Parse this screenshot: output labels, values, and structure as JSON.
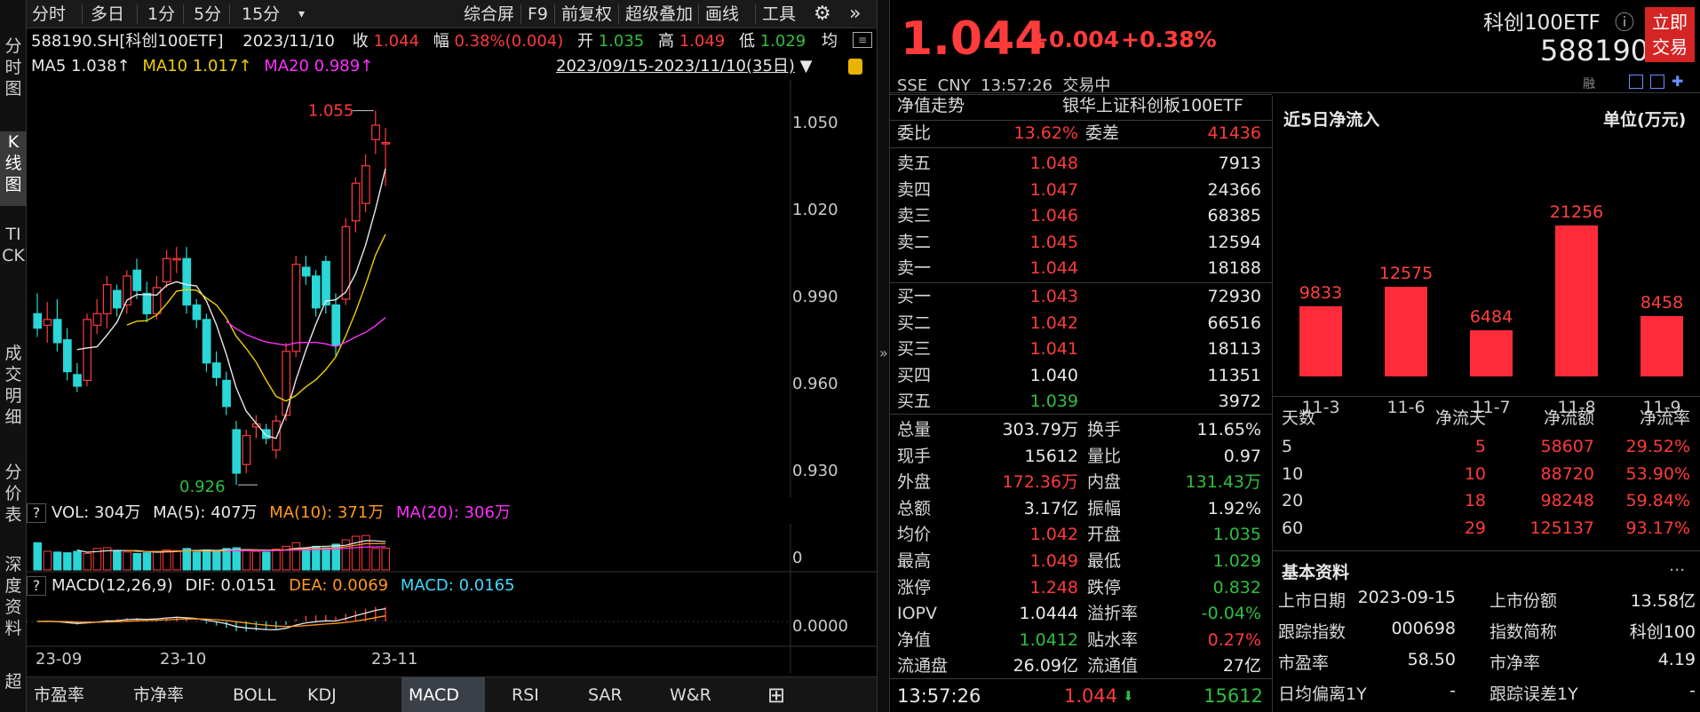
{
  "vtabs": [
    "分时图",
    "K线图",
    "TICK",
    "成交明细",
    "分价表",
    "深度资料",
    "超"
  ],
  "toolbar": {
    "left": [
      "分时",
      "多日",
      "1分",
      "5分",
      "15分"
    ],
    "dropdown": "▾",
    "right": [
      "综合屏",
      "F9",
      "前复权",
      "超级叠加",
      "画线",
      "工具"
    ],
    "gear_icon": "⚙",
    "more_icon": "»"
  },
  "info": {
    "code_name": "588190.SH[科创100ETF]",
    "date": "2023/11/10",
    "close_label": "收",
    "close": "1.044",
    "change_label": "幅",
    "change": "0.38%(0.004)",
    "open_label": "开",
    "open": "1.035",
    "high_label": "高",
    "high": "1.049",
    "low_label": "低",
    "low": "1.029",
    "trailing": "均"
  },
  "ma": {
    "ma5": "MA5 1.038↑",
    "ma10": "MA10 1.017↑",
    "ma20": "MA20 0.989↑",
    "range": "2023/09/15-2023/11/10(35日)",
    "range_arrow": "▼"
  },
  "price_axis": [
    "1.050",
    "1.020",
    "0.990",
    "0.960",
    "0.930"
  ],
  "annotations": {
    "high": "1.055",
    "low": "0.926"
  },
  "candles": [
    {
      "o": 0.985,
      "h": 0.992,
      "l": 0.977,
      "c": 0.98
    },
    {
      "o": 0.981,
      "h": 0.989,
      "l": 0.975,
      "c": 0.983
    },
    {
      "o": 0.983,
      "h": 0.99,
      "l": 0.972,
      "c": 0.975
    },
    {
      "o": 0.976,
      "h": 0.98,
      "l": 0.962,
      "c": 0.965
    },
    {
      "o": 0.964,
      "h": 0.968,
      "l": 0.958,
      "c": 0.96
    },
    {
      "o": 0.962,
      "h": 0.985,
      "l": 0.96,
      "c": 0.983
    },
    {
      "o": 0.981,
      "h": 0.99,
      "l": 0.978,
      "c": 0.985
    },
    {
      "o": 0.985,
      "h": 0.998,
      "l": 0.98,
      "c": 0.995
    },
    {
      "o": 0.993,
      "h": 0.995,
      "l": 0.984,
      "c": 0.987
    },
    {
      "o": 0.988,
      "h": 1.0,
      "l": 0.985,
      "c": 0.998
    },
    {
      "o": 1.0,
      "h": 1.004,
      "l": 0.99,
      "c": 0.993
    },
    {
      "o": 0.992,
      "h": 0.996,
      "l": 0.982,
      "c": 0.985
    },
    {
      "o": 0.985,
      "h": 0.998,
      "l": 0.983,
      "c": 0.994
    },
    {
      "o": 0.996,
      "h": 1.007,
      "l": 0.994,
      "c": 1.004
    },
    {
      "o": 1.004,
      "h": 1.008,
      "l": 0.999,
      "c": 1.004
    },
    {
      "o": 1.004,
      "h": 1.008,
      "l": 0.985,
      "c": 0.988
    },
    {
      "o": 0.988,
      "h": 0.99,
      "l": 0.98,
      "c": 0.983
    },
    {
      "o": 0.983,
      "h": 0.985,
      "l": 0.965,
      "c": 0.968
    },
    {
      "o": 0.968,
      "h": 0.972,
      "l": 0.96,
      "c": 0.963
    },
    {
      "o": 0.962,
      "h": 0.965,
      "l": 0.95,
      "c": 0.953
    },
    {
      "o": 0.945,
      "h": 0.948,
      "l": 0.926,
      "c": 0.93
    },
    {
      "o": 0.933,
      "h": 0.945,
      "l": 0.93,
      "c": 0.943
    },
    {
      "o": 0.946,
      "h": 0.95,
      "l": 0.942,
      "c": 0.947
    },
    {
      "o": 0.945,
      "h": 0.947,
      "l": 0.94,
      "c": 0.942
    },
    {
      "o": 0.938,
      "h": 0.95,
      "l": 0.935,
      "c": 0.948
    },
    {
      "o": 0.95,
      "h": 0.975,
      "l": 0.948,
      "c": 0.972
    },
    {
      "o": 0.972,
      "h": 1.005,
      "l": 0.97,
      "c": 1.002
    },
    {
      "o": 1.001,
      "h": 1.005,
      "l": 0.995,
      "c": 0.998
    },
    {
      "o": 0.998,
      "h": 1.0,
      "l": 0.984,
      "c": 0.987
    },
    {
      "o": 1.003,
      "h": 1.005,
      "l": 0.985,
      "c": 0.988
    },
    {
      "o": 0.988,
      "h": 0.992,
      "l": 0.97,
      "c": 0.974
    },
    {
      "o": 0.99,
      "h": 1.018,
      "l": 0.988,
      "c": 1.015
    },
    {
      "o": 1.017,
      "h": 1.032,
      "l": 1.013,
      "c": 1.03
    },
    {
      "o": 1.023,
      "h": 1.04,
      "l": 1.02,
      "c": 1.036
    },
    {
      "o": 1.045,
      "h": 1.055,
      "l": 1.04,
      "c": 1.05
    },
    {
      "o": 1.044,
      "h": 1.049,
      "l": 1.029,
      "c": 1.044
    }
  ],
  "vol_header": {
    "q": "?",
    "vol": "VOL: 304万",
    "ma5": "MA(5): 407万",
    "ma10": "MA(10): 371万",
    "ma20": "MA(20): 306万",
    "zero": "0"
  },
  "volumes": [
    380,
    260,
    250,
    240,
    260,
    230,
    300,
    310,
    260,
    250,
    230,
    240,
    260,
    280,
    270,
    300,
    250,
    280,
    260,
    300,
    310,
    270,
    260,
    250,
    290,
    330,
    380,
    300,
    330,
    310,
    360,
    420,
    470,
    480,
    300,
    304
  ],
  "macd_header": {
    "q": "?",
    "title": "MACD(12,26,9)",
    "dif": "DIF: 0.0151",
    "dea": "DEA: 0.0069",
    "macd": "MACD: 0.0165",
    "zero": "0.0000"
  },
  "x_axis": [
    "23-09",
    "23-10",
    "23-11"
  ],
  "bottom_tabs": [
    "市盈率",
    "市净率",
    "BOLL",
    "KDJ",
    "MACD",
    "RSI",
    "SAR",
    "W&R"
  ],
  "bottom_add": "⊞",
  "quote": {
    "price": "1.044",
    "change": "+0.004",
    "pct": "+0.38%",
    "meta": "SSE  CNY  13:57:26  交易中",
    "name": "科创100ETF",
    "code": "588190",
    "info_icon": "ⓘ",
    "trade_btn": "立即\n交易",
    "nav_tab": "净值走势",
    "fund_name": "银华上证科创板100ETF",
    "weibi_label": "委比",
    "weibi": "13.62%",
    "weicha_label": "委差",
    "weicha": "41436",
    "sells": [
      {
        "label": "卖五",
        "price": "1.048",
        "vol": "7913"
      },
      {
        "label": "卖四",
        "price": "1.047",
        "vol": "24366"
      },
      {
        "label": "卖三",
        "price": "1.046",
        "vol": "68385"
      },
      {
        "label": "卖二",
        "price": "1.045",
        "vol": "12594"
      },
      {
        "label": "卖一",
        "price": "1.044",
        "vol": "18188"
      }
    ],
    "buys": [
      {
        "label": "买一",
        "price": "1.043",
        "vol": "72930",
        "color": "red"
      },
      {
        "label": "买二",
        "price": "1.042",
        "vol": "66516",
        "color": "red"
      },
      {
        "label": "买三",
        "price": "1.041",
        "vol": "18113",
        "color": "red"
      },
      {
        "label": "买四",
        "price": "1.040",
        "vol": "11351",
        "color": "white"
      },
      {
        "label": "买五",
        "price": "1.039",
        "vol": "3972",
        "color": "green"
      }
    ],
    "stats": [
      {
        "l1": "总量",
        "v1": "303.79万",
        "c1": "white",
        "l2": "换手",
        "v2": "11.65%",
        "c2": "white"
      },
      {
        "l1": "现手",
        "v1": "15612",
        "c1": "white",
        "l2": "量比",
        "v2": "0.97",
        "c2": "white"
      },
      {
        "l1": "外盘",
        "v1": "172.36万",
        "c1": "red",
        "l2": "内盘",
        "v2": "131.43万",
        "c2": "green"
      },
      {
        "l1": "总额",
        "v1": "3.17亿",
        "c1": "white",
        "l2": "振幅",
        "v2": "1.92%",
        "c2": "white"
      },
      {
        "l1": "均价",
        "v1": "1.042",
        "c1": "red",
        "l2": "开盘",
        "v2": "1.035",
        "c2": "green"
      },
      {
        "l1": "最高",
        "v1": "1.049",
        "c1": "red",
        "l2": "最低",
        "v2": "1.029",
        "c2": "green"
      },
      {
        "l1": "涨停",
        "v1": "1.248",
        "c1": "red",
        "l2": "跌停",
        "v2": "0.832",
        "c2": "green"
      },
      {
        "l1": "IOPV",
        "v1": "1.0444",
        "c1": "white",
        "l2": "溢折率",
        "v2": "-0.04%",
        "c2": "green"
      },
      {
        "l1": "净值",
        "v1": "1.0412",
        "c1": "green",
        "l2": "贴水率",
        "v2": "0.27%",
        "c2": "red"
      },
      {
        "l1": "流通盘",
        "v1": "26.09亿",
        "c1": "white",
        "l2": "流通值",
        "v2": "27亿",
        "c2": "white"
      }
    ],
    "tick": {
      "time": "13:57:26",
      "price": "1.044",
      "arrow": "⬇",
      "vol": "15612"
    }
  },
  "flow": {
    "title": "近5日净流入",
    "unit": "单位(万元)",
    "chart_data": {
      "type": "bar",
      "categories": [
        "11-3",
        "11-6",
        "11-7",
        "11-8",
        "11-9"
      ],
      "values": [
        9833,
        12575,
        6484,
        21256,
        8458
      ],
      "title": "近5日净流入",
      "ylabel": "单位(万元)"
    },
    "table_headers": [
      "天数",
      "净流天",
      "净流额",
      "净流率"
    ],
    "table_rows": [
      [
        "5",
        "5",
        "58607",
        "29.52%"
      ],
      [
        "10",
        "10",
        "88720",
        "53.90%"
      ],
      [
        "20",
        "18",
        "98248",
        "59.84%"
      ],
      [
        "60",
        "29",
        "125137",
        "93.17%"
      ]
    ],
    "basic_title": "基本资料",
    "basic_more": "...",
    "basic_rows": [
      [
        "上市日期",
        "2023-09-15",
        "上市份额",
        "13.58亿"
      ],
      [
        "跟踪指数",
        "000698",
        "指数简称",
        "科创100"
      ],
      [
        "市盈率",
        "58.50",
        "市净率",
        "4.19"
      ],
      [
        "日均偏离1Y",
        "-",
        "跟踪误差1Y",
        "-"
      ]
    ]
  }
}
